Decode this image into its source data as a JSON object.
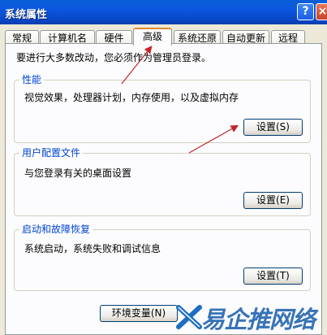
{
  "window": {
    "title": "系统属性"
  },
  "tabs": [
    "常规",
    "计算机名",
    "硬件",
    "高级",
    "系统还原",
    "自动更新",
    "远程"
  ],
  "intro_text": "要进行大多数改动，您必须作为管理员登录。",
  "performance": {
    "legend": "性能",
    "description": "视觉效果，处理器计划，内存使用，以及虚拟内存",
    "button": "设置(S)"
  },
  "user_profiles": {
    "legend": "用户配置文件",
    "description": "与您登录有关的桌面设置",
    "button": "设置(E)"
  },
  "startup_recovery": {
    "legend": "启动和故障恢复",
    "description": "系统启动，系统失败和调试信息",
    "button": "设置(T)"
  },
  "env_button": "环境变量(N)",
  "watermark": "易企推网络",
  "colors": {
    "titlebar": "#0a56e0",
    "legend": "#0046d5",
    "active_tab_top": "#e68b2c",
    "arrow": "#c0282a"
  }
}
